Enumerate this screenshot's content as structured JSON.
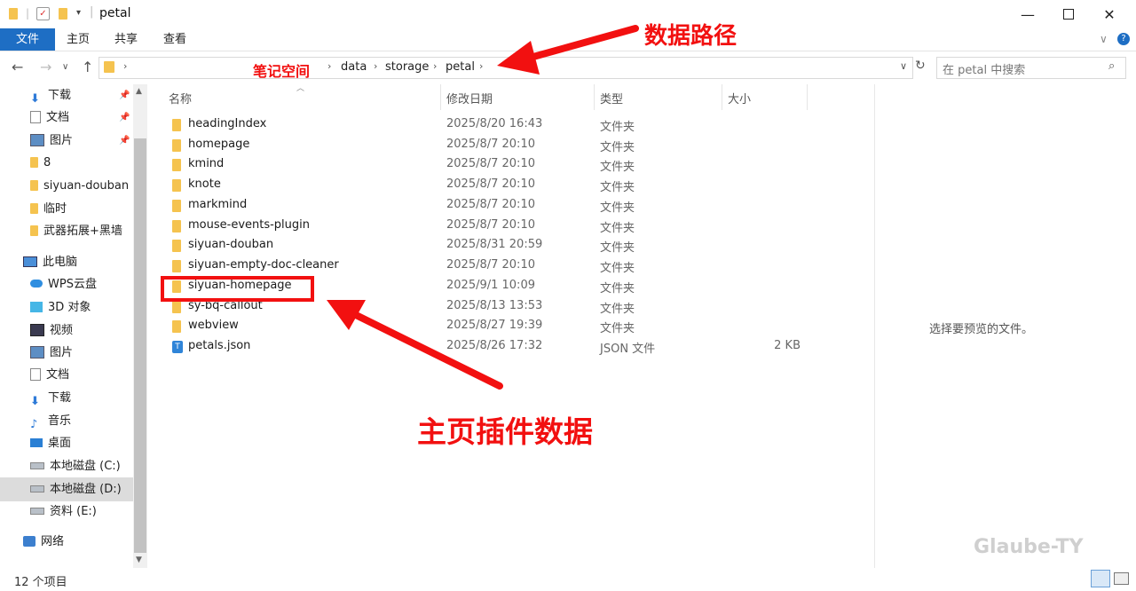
{
  "window": {
    "title": "petal",
    "minimize_icon": "minimize-icon",
    "maximize_icon": "maximize-icon",
    "close_icon": "close-icon"
  },
  "ribbon": {
    "tabs": [
      "文件",
      "主页",
      "共享",
      "查看"
    ]
  },
  "address": {
    "breadcrumbs": [
      "data",
      "storage",
      "petal"
    ],
    "search_placeholder": "在 petal 中搜索"
  },
  "sidebar": {
    "quick_access": [
      {
        "label": "下载",
        "icon": "download-icon",
        "pinned": true
      },
      {
        "label": "文档",
        "icon": "document-icon",
        "pinned": true
      },
      {
        "label": "图片",
        "icon": "picture-icon",
        "pinned": true
      },
      {
        "label": "8",
        "icon": "folder-icon",
        "pinned": false
      },
      {
        "label": "siyuan-douban",
        "icon": "folder-icon",
        "pinned": false
      },
      {
        "label": "临时",
        "icon": "folder-icon",
        "pinned": false
      },
      {
        "label": "武器拓展+黑墙",
        "icon": "folder-icon",
        "pinned": false
      }
    ],
    "this_pc": "此电脑",
    "pc_items": [
      {
        "label": "WPS云盘",
        "icon": "cloud-icon"
      },
      {
        "label": "3D 对象",
        "icon": "3d-object-icon"
      },
      {
        "label": "视频",
        "icon": "video-icon"
      },
      {
        "label": "图片",
        "icon": "picture-icon"
      },
      {
        "label": "文档",
        "icon": "document-icon"
      },
      {
        "label": "下载",
        "icon": "download-icon"
      },
      {
        "label": "音乐",
        "icon": "music-icon"
      },
      {
        "label": "桌面",
        "icon": "desktop-icon"
      },
      {
        "label": "本地磁盘 (C:)",
        "icon": "drive-icon"
      },
      {
        "label": "本地磁盘 (D:)",
        "icon": "drive-icon",
        "selected": true
      },
      {
        "label": "资料 (E:)",
        "icon": "drive-icon"
      }
    ],
    "network": "网络"
  },
  "columns": [
    "名称",
    "修改日期",
    "类型",
    "大小"
  ],
  "files": [
    {
      "name": "headingIndex",
      "date": "2025/8/20 16:43",
      "type": "文件夹",
      "size": ""
    },
    {
      "name": "homepage",
      "date": "2025/8/7 20:10",
      "type": "文件夹",
      "size": ""
    },
    {
      "name": "kmind",
      "date": "2025/8/7 20:10",
      "type": "文件夹",
      "size": ""
    },
    {
      "name": "knote",
      "date": "2025/8/7 20:10",
      "type": "文件夹",
      "size": ""
    },
    {
      "name": "markmind",
      "date": "2025/8/7 20:10",
      "type": "文件夹",
      "size": ""
    },
    {
      "name": "mouse-events-plugin",
      "date": "2025/8/7 20:10",
      "type": "文件夹",
      "size": ""
    },
    {
      "name": "siyuan-douban",
      "date": "2025/8/31 20:59",
      "type": "文件夹",
      "size": ""
    },
    {
      "name": "siyuan-empty-doc-cleaner",
      "date": "2025/8/7 20:10",
      "type": "文件夹",
      "size": ""
    },
    {
      "name": "siyuan-homepage",
      "date": "2025/9/1 10:09",
      "type": "文件夹",
      "size": ""
    },
    {
      "name": "sy-bq-callout",
      "date": "2025/8/13 13:53",
      "type": "文件夹",
      "size": ""
    },
    {
      "name": "webview",
      "date": "2025/8/27 19:39",
      "type": "文件夹",
      "size": ""
    },
    {
      "name": "petals.json",
      "date": "2025/8/26 17:32",
      "type": "JSON 文件",
      "size": "2 KB"
    }
  ],
  "preview_text": "选择要预览的文件。",
  "status": "12 个项目",
  "watermark": "Glaube-TY",
  "annotations": {
    "data_path": "数据路径",
    "notebook_space": "笔记空间",
    "homepage_plugin_data": "主页插件数据",
    "color": "#f21010"
  }
}
